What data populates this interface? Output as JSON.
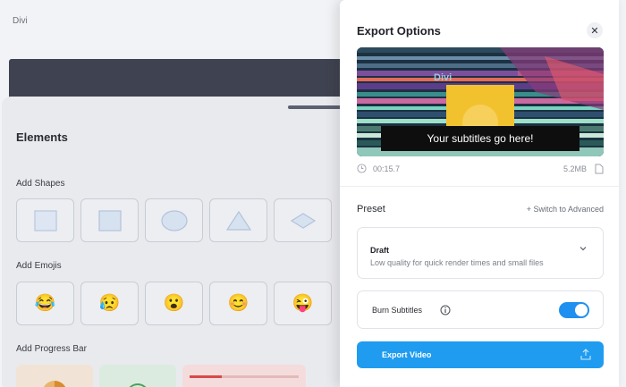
{
  "app": {
    "title": "Divi"
  },
  "elements": {
    "title": "Elements",
    "shapes_label": "Add Shapes",
    "shapes": [
      "square-outline-shape",
      "square-shape",
      "circle-shape",
      "triangle-shape",
      "diamond-shape"
    ],
    "emojis_label": "Add Emojis",
    "emojis": [
      "😂",
      "😥",
      "😮",
      "😊",
      "😜"
    ],
    "progress_label": "Add Progress Bar"
  },
  "dialog": {
    "title": "Export Options",
    "close_icon": "close-icon",
    "preview": {
      "subtitle_text": "Your subtitles go here!",
      "overlay_text": "Divi",
      "duration": "00:15.7",
      "size": "5.2MB"
    },
    "preset_label": "Preset",
    "switch_advanced": "+ Switch to Advanced",
    "preset": {
      "name": "Draft",
      "description": "Low quality for quick render times and small files"
    },
    "burn_subtitles": {
      "label": "Burn Subtitles",
      "enabled": true
    },
    "export_button": "Export Video"
  },
  "colors": {
    "accent": "#1f9cf0",
    "toggle": "#1f8ff0",
    "panel_bg": "#e9eaee",
    "dark_bar": "#3f4250"
  }
}
